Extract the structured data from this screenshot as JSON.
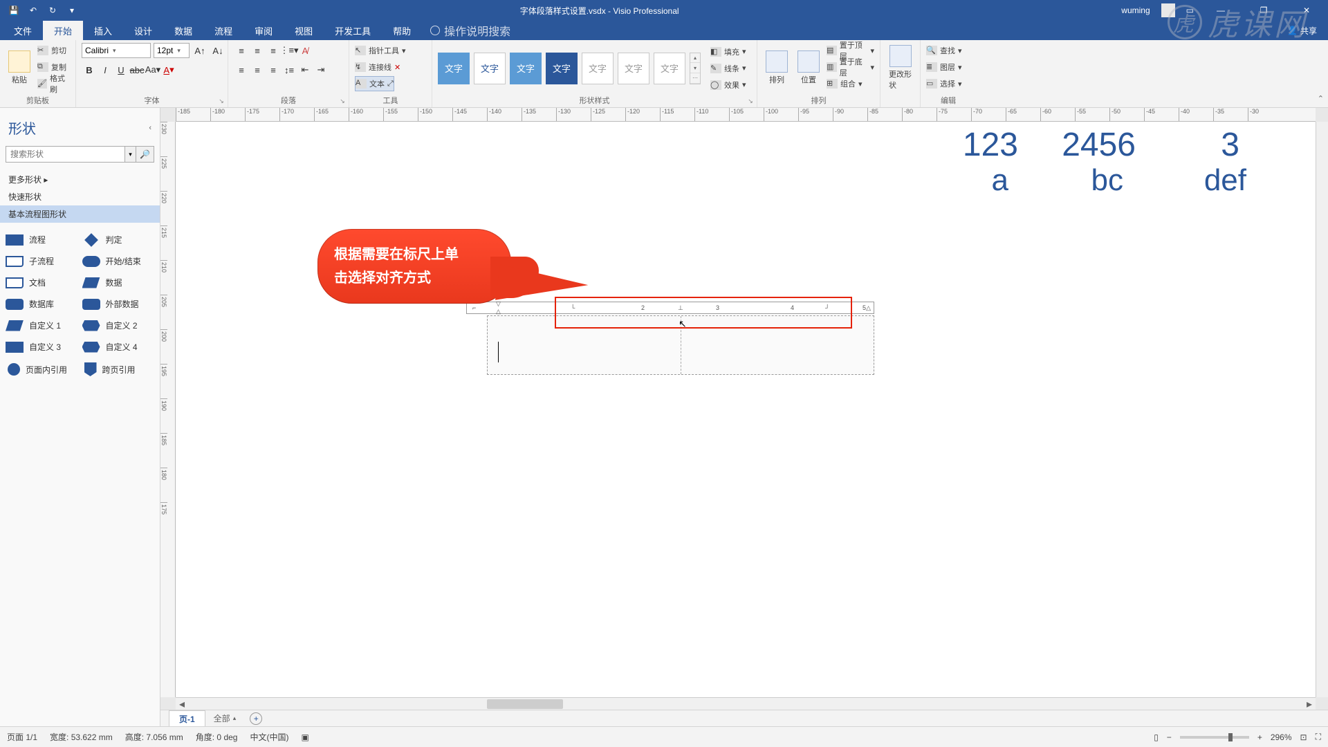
{
  "title": "字体段落样式设置.vsdx  -  Visio Professional",
  "user": "wuming",
  "share": "共享",
  "qat": {
    "save": "💾",
    "undo": "↶",
    "redo": "↻"
  },
  "tabs": [
    "文件",
    "开始",
    "插入",
    "设计",
    "数据",
    "流程",
    "审阅",
    "视图",
    "开发工具",
    "帮助"
  ],
  "active_tab": "开始",
  "tell_me": "操作说明搜索",
  "ribbon": {
    "clipboard": {
      "paste": "粘贴",
      "cut": "剪切",
      "copy": "复制",
      "format_painter": "格式刷",
      "label": "剪贴板"
    },
    "font": {
      "face": "Calibri",
      "size": "12pt",
      "label": "字体"
    },
    "paragraph": {
      "label": "段落"
    },
    "tools": {
      "pointer": "指针工具",
      "connector": "连接线",
      "text": "文本",
      "label": "工具"
    },
    "styles": {
      "label": "形状样式",
      "item": "文字"
    },
    "fill": "填充",
    "line": "线条",
    "effects": "效果",
    "arrange": {
      "align": "排列",
      "position": "位置",
      "bring_front": "置于顶层",
      "send_back": "置于底层",
      "group": "组合",
      "label": "排列"
    },
    "change_shape": "更改形状",
    "edit": {
      "find": "查找",
      "layers": "图层",
      "select": "选择",
      "label": "编辑"
    }
  },
  "shapes": {
    "title": "形状",
    "search_ph": "搜索形状",
    "more": "更多形状",
    "quick": "快速形状",
    "basic": "基本流程图形状",
    "items": [
      {
        "n": "流程"
      },
      {
        "n": "判定"
      },
      {
        "n": "子流程"
      },
      {
        "n": "开始/结束"
      },
      {
        "n": "文档"
      },
      {
        "n": "数据"
      },
      {
        "n": "数据库"
      },
      {
        "n": "外部数据"
      },
      {
        "n": "自定义 1"
      },
      {
        "n": "自定义 2"
      },
      {
        "n": "自定义 3"
      },
      {
        "n": "自定义 4"
      },
      {
        "n": "页面内引用"
      },
      {
        "n": "跨页引用"
      }
    ]
  },
  "ruler_h": [
    "-185",
    "-180",
    "-175",
    "-170",
    "-165",
    "-160",
    "-155",
    "-150",
    "-145",
    "-140",
    "-135",
    "-130",
    "-125",
    "-120",
    "-115",
    "-110",
    "-105",
    "-100",
    "-95",
    "-90",
    "-85",
    "-80",
    "-75",
    "-70",
    "-65",
    "-60",
    "-55",
    "-50",
    "-45",
    "-40",
    "-35",
    "-30"
  ],
  "ruler_v": [
    "230",
    "225",
    "220",
    "215",
    "210",
    "205",
    "200",
    "195",
    "190",
    "185",
    "180",
    "175"
  ],
  "callout": {
    "l1": "根据需要在标尺上单",
    "l2": "击选择对齐方式"
  },
  "canvas_text": {
    "n1": "123",
    "n2": "2456",
    "n3": "3",
    "l1": "a",
    "l2": "bc",
    "l3": "def"
  },
  "inner_ruler": [
    "2",
    "3",
    "4",
    "5"
  ],
  "page_tabs": {
    "p1": "页-1",
    "all": "全部"
  },
  "status": {
    "page": "页面 1/1",
    "width": "宽度: 53.622 mm",
    "height": "高度: 7.056 mm",
    "angle": "角度: 0 deg",
    "lang": "中文(中国)",
    "zoom": "296%"
  },
  "watermark": "虎课网"
}
